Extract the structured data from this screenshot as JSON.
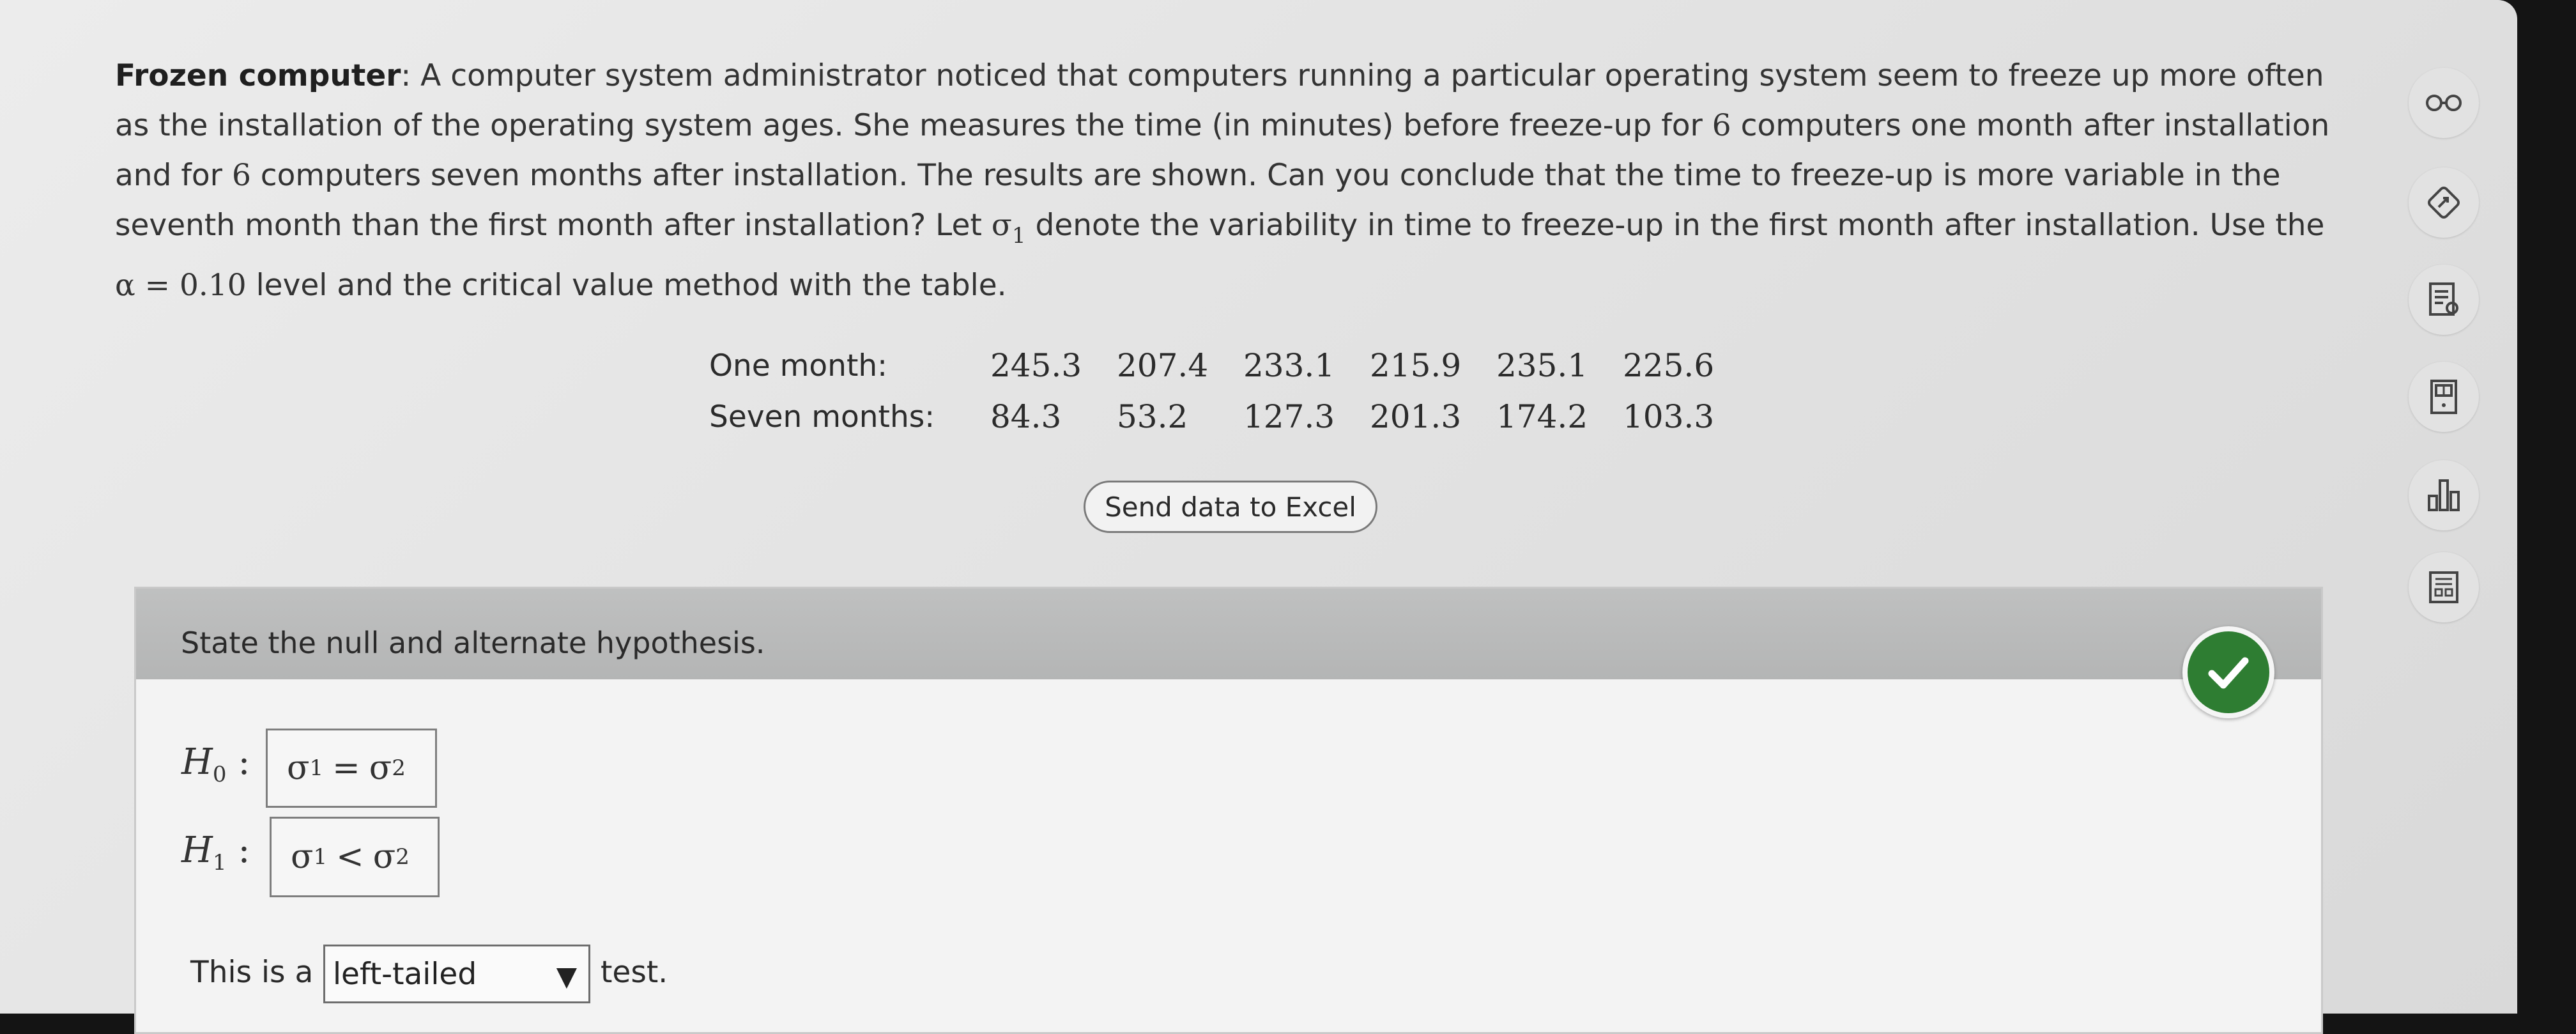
{
  "problem": {
    "title": "Frozen computer",
    "text_1": ": A computer system administrator noticed that computers running a particular operating system seem to freeze up more often as the installation of the operating system ages. She measures the time (in minutes) before freeze-up for ",
    "n1": "6",
    "text_2": " computers one month after installation and for ",
    "n2": "6",
    "text_3": " computers seven months after installation. The results are shown. Can you conclude that the time to freeze-up is more variable in the seventh month than the first month after installation? Let ",
    "sigma_symbol": "σ",
    "sigma_sub": "1",
    "text_4": " denote the variability in time to freeze-up in the first month after installation. Use the ",
    "alpha_expr": "α = 0.10",
    "text_5": " level and the critical value method with the table."
  },
  "table": {
    "rows": [
      {
        "label": "One month:",
        "values": [
          "245.3",
          "207.4",
          "233.1",
          "215.9",
          "235.1",
          "225.6"
        ]
      },
      {
        "label": "Seven months:",
        "values": [
          "84.3",
          "53.2",
          "127.3",
          "201.3",
          "174.2",
          "103.3"
        ]
      }
    ]
  },
  "excel_button": {
    "label": "Send data to Excel"
  },
  "question": {
    "prompt": "State the null and alternate hypothesis.",
    "h0": {
      "label": "H",
      "sub": "0",
      "colon": ":",
      "left": "σ",
      "left_sub": "1",
      "op": "=",
      "right": "σ",
      "right_sub": "2"
    },
    "h1": {
      "label": "H",
      "sub": "1",
      "colon": ":",
      "left": "σ",
      "left_sub": "1",
      "op": "<",
      "right": "σ",
      "right_sub": "2"
    },
    "tail_prefix": "This is a",
    "tail_value": "left-tailed",
    "tail_suffix": "test."
  },
  "colors": {
    "correct_badge": "#2e7d32",
    "panel_header": "#b8b9b9"
  },
  "sidebar_icons": [
    "glasses-icon",
    "edit-icon",
    "notes-icon",
    "calculator-icon",
    "chart-icon",
    "worksheet-icon"
  ]
}
